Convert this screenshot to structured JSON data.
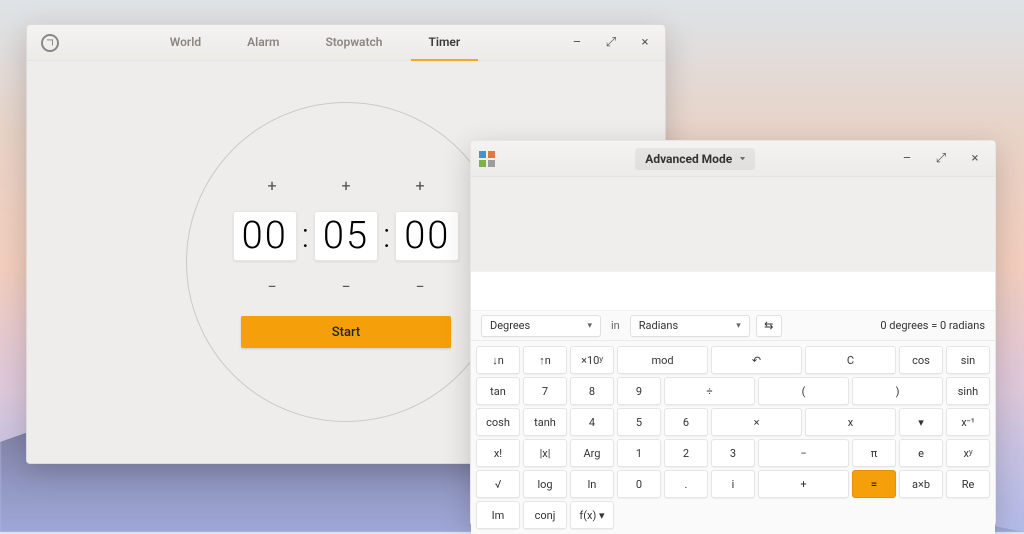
{
  "clocks": {
    "tabs": {
      "world": "World",
      "alarm": "Alarm",
      "stopwatch": "Stopwatch",
      "timer": "Timer"
    },
    "active_tab": "timer",
    "timer": {
      "hours": "00",
      "minutes": "05",
      "seconds": "00",
      "start_label": "Start",
      "plus": "+",
      "minus": "−"
    }
  },
  "calc": {
    "mode_label": "Advanced Mode",
    "history": "",
    "input": "",
    "conversion": {
      "from_unit": "Degrees",
      "in_label": "in",
      "to_unit": "Radians",
      "swap_glyph": "⇆",
      "result": "0 degrees  =  0 radians"
    },
    "keys": [
      [
        "↓n",
        "↑n",
        "×10ʸ",
        "mod",
        "↶",
        "C",
        "cos",
        "sin",
        "tan"
      ],
      [
        "7",
        "8",
        "9",
        "÷",
        "(",
        ")",
        "sinh",
        "cosh",
        "tanh"
      ],
      [
        "4",
        "5",
        "6",
        "×",
        "x",
        "▾",
        "x⁻¹",
        "x!",
        "|x|",
        "Arg"
      ],
      [
        "1",
        "2",
        "3",
        "−",
        "π",
        "e",
        "xʸ",
        "√",
        "log",
        "ln"
      ],
      [
        "0",
        ".",
        "i",
        "+",
        "=",
        "a×b",
        "Re",
        "Im",
        "conj",
        "f(x) ▾"
      ]
    ],
    "row0_span": {
      "0": 1,
      "1": 1,
      "2": 1,
      "3": 2,
      "4": 2,
      "5": 2,
      "6": 1,
      "7": 1,
      "8": 1
    },
    "row1_span": {
      "0": 1,
      "1": 1,
      "2": 1,
      "3": 2,
      "4": 2,
      "5": 2,
      "6": 1,
      "7": 1,
      "8": 1
    }
  }
}
